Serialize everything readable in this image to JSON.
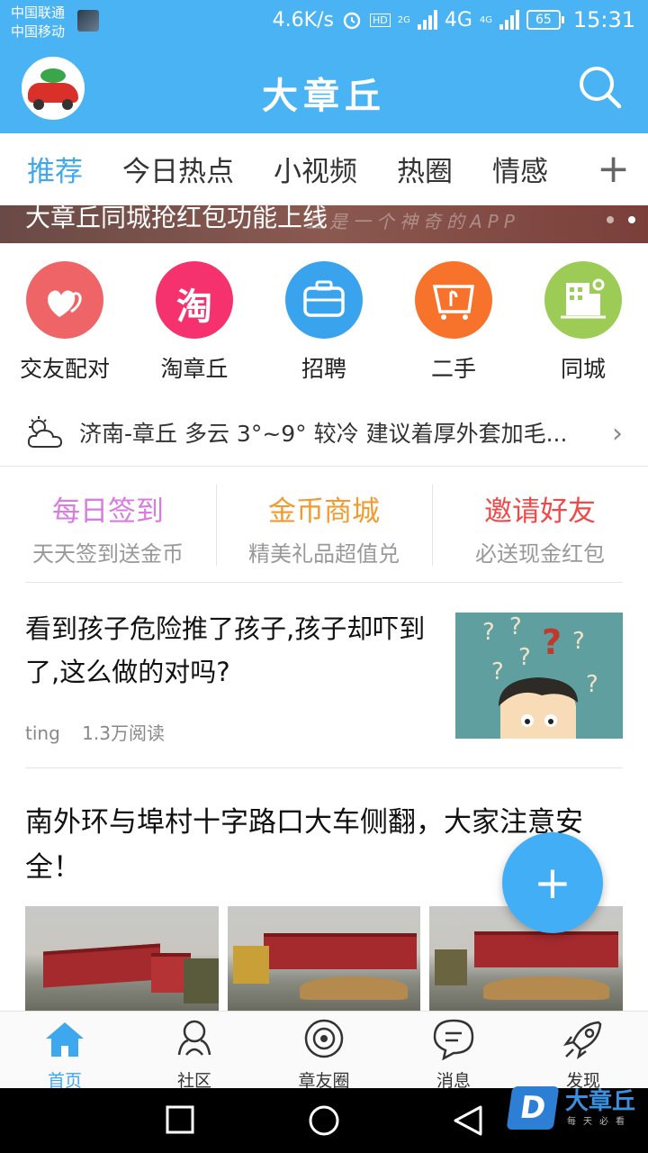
{
  "status_bar": {
    "carrier1": "中国联通",
    "carrier2": "中国移动",
    "speed": "4.6K/s",
    "net1": "2G",
    "net2": "4G",
    "net3": "4G",
    "hd": "HD",
    "battery": "65",
    "time": "15:31"
  },
  "header": {
    "title": "大章丘"
  },
  "tabs": [
    "推荐",
    "今日热点",
    "小视频",
    "热圈",
    "情感"
  ],
  "tab_add_label": "+",
  "banner": {
    "text": "大章丘同城抢红包功能上线",
    "watermark": "丘是一个神奇的APP"
  },
  "quick_items": [
    {
      "label": "交友配对",
      "color": "#ef6467",
      "icon": "hearts-icon"
    },
    {
      "label": "淘章丘",
      "color": "#f5326e",
      "icon": "tao-icon",
      "glyph": "淘"
    },
    {
      "label": "招聘",
      "color": "#3aa3ee",
      "icon": "briefcase-icon"
    },
    {
      "label": "二手",
      "color": "#f7722a",
      "icon": "cart-icon"
    },
    {
      "label": "同城",
      "color": "#9ccc55",
      "icon": "building-icon"
    }
  ],
  "weather": {
    "text": "济南-章丘 多云 3°~9° 较冷 建议着厚外套加毛..."
  },
  "actions": [
    {
      "title": "每日签到",
      "sub": "天天签到送金币",
      "color": "#d97be0"
    },
    {
      "title": "金币商城",
      "sub": "精美礼品超值兑",
      "color": "#f29a2e"
    },
    {
      "title": "邀请好友",
      "sub": "必送现金红包",
      "color": "#ee4a4a"
    }
  ],
  "article1": {
    "title": "看到孩子危险推了孩子,孩子却吓到了,这么做的对吗?",
    "author": "ting",
    "reads": "1.3万阅读"
  },
  "article2": {
    "title": "南外环与埠村十字路口大车侧翻，大家注意安全！"
  },
  "fab_label": "+",
  "bottom_nav": [
    {
      "label": "首页",
      "icon": "home-icon"
    },
    {
      "label": "社区",
      "icon": "community-icon"
    },
    {
      "label": "章友圈",
      "icon": "circle-icon"
    },
    {
      "label": "消息",
      "icon": "message-icon"
    },
    {
      "label": "发现",
      "icon": "rocket-icon"
    }
  ],
  "watermark_logo": {
    "brand": "大章丘",
    "tagline": "每天必看",
    "letter": "D"
  },
  "colors": {
    "brand_blue": "#4ab3f4",
    "active_tab": "#3da8ee"
  }
}
